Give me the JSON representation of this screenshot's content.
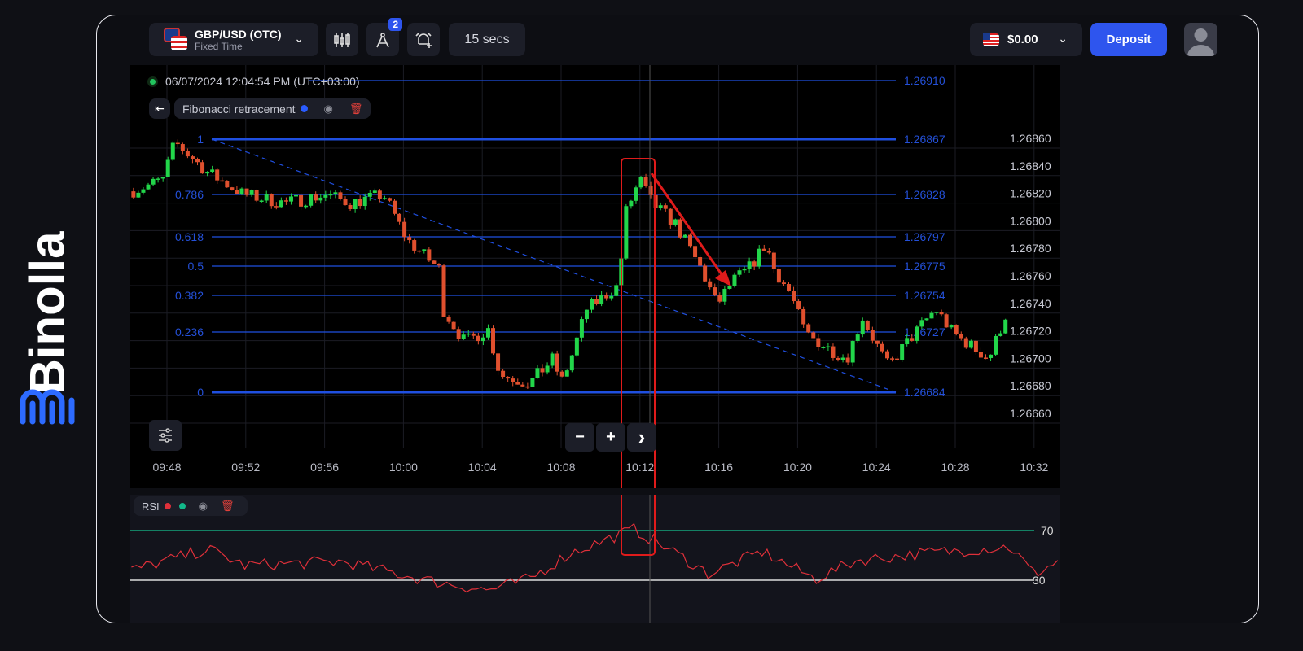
{
  "brand": "Binolla",
  "header": {
    "asset": "GBP/USD (OTC)",
    "asset_type": "Fixed Time",
    "drawings_badge": "2",
    "timeframe": "15 secs",
    "balance": "$0.00",
    "deposit": "Deposit"
  },
  "chart": {
    "timestamp": "06/07/2024 12:04:54 PM  (UTC+03:00)",
    "indicator_label": "Fibonacci retracement",
    "fib_levels": [
      {
        "ratio": "",
        "price": "1.26910"
      },
      {
        "ratio": "1",
        "price": "1.26867"
      },
      {
        "ratio": "0.786",
        "price": "1.26828"
      },
      {
        "ratio": "0.618",
        "price": "1.26797"
      },
      {
        "ratio": "0.5",
        "price": "1.26775"
      },
      {
        "ratio": "0.382",
        "price": "1.26754"
      },
      {
        "ratio": "0.236",
        "price": "1.26727"
      },
      {
        "ratio": "0",
        "price": "1.26684"
      }
    ],
    "price_ticks": [
      "1.26860",
      "1.26840",
      "1.26820",
      "1.26800",
      "1.26780",
      "1.26760",
      "1.26740",
      "1.26720",
      "1.26700",
      "1.26680",
      "1.26660"
    ],
    "time_ticks": [
      "09:48",
      "09:52",
      "09:56",
      "10:00",
      "10:04",
      "10:08",
      "10:12",
      "10:16",
      "10:20",
      "10:24",
      "10:28",
      "10:32"
    ],
    "zoom_out": "−",
    "zoom_in": "+",
    "next": "›",
    "colors": {
      "up": "#22d64a",
      "down": "#e0502e",
      "fib": "#1f4fe0",
      "annotation": "#e01b1b"
    }
  },
  "chart_data": {
    "type": "candlestick",
    "x_unit": "minutes after 09:48",
    "price_path": [
      [
        -1.7,
        1.26822
      ],
      [
        -0.2,
        1.2683
      ],
      [
        0.4,
        1.26857
      ],
      [
        2.1,
        1.26835
      ],
      [
        3.9,
        1.26819
      ],
      [
        6.0,
        1.26813
      ],
      [
        8.1,
        1.26819
      ],
      [
        9.3,
        1.26813
      ],
      [
        11.0,
        1.26819
      ],
      [
        12.2,
        1.26786
      ],
      [
        13.8,
        1.26765
      ],
      [
        14.0,
        1.26736
      ],
      [
        15.1,
        1.26712
      ],
      [
        16.3,
        1.26721
      ],
      [
        16.9,
        1.26688
      ],
      [
        18.4,
        1.26682
      ],
      [
        19.6,
        1.267
      ],
      [
        20.0,
        1.26682
      ],
      [
        20.5,
        1.267
      ],
      [
        21.3,
        1.26736
      ],
      [
        22.9,
        1.26753
      ],
      [
        23.3,
        1.26807
      ],
      [
        24.0,
        1.2683
      ],
      [
        24.6,
        1.26813
      ],
      [
        25.8,
        1.26798
      ],
      [
        27.1,
        1.26765
      ],
      [
        27.9,
        1.26739
      ],
      [
        28.7,
        1.26756
      ],
      [
        29.5,
        1.26765
      ],
      [
        30.4,
        1.26783
      ],
      [
        30.8,
        1.26765
      ],
      [
        31.6,
        1.26748
      ],
      [
        32.4,
        1.26718
      ],
      [
        33.7,
        1.26706
      ],
      [
        34.5,
        1.267
      ],
      [
        35.3,
        1.2673
      ],
      [
        35.7,
        1.26718
      ],
      [
        36.6,
        1.26694
      ],
      [
        37.4,
        1.26709
      ],
      [
        39.0,
        1.26736
      ],
      [
        39.9,
        1.26718
      ],
      [
        41.1,
        1.26706
      ],
      [
        41.7,
        1.267
      ],
      [
        42.6,
        1.26733
      ]
    ],
    "rsi": {
      "label": "RSI",
      "upper": "70",
      "lower": "30",
      "path": [
        [
          -1.8,
          38
        ],
        [
          2.1,
          55
        ],
        [
          3.9,
          42
        ],
        [
          8.9,
          45
        ],
        [
          13.5,
          29
        ],
        [
          16.3,
          22
        ],
        [
          18.4,
          31
        ],
        [
          20.5,
          52
        ],
        [
          23.7,
          71
        ],
        [
          25.8,
          52
        ],
        [
          27.5,
          35
        ],
        [
          30.2,
          53
        ],
        [
          32.9,
          31
        ],
        [
          35.0,
          46
        ],
        [
          38.6,
          52
        ],
        [
          42.8,
          57
        ],
        [
          44.0,
          35
        ],
        [
          45.2,
          45
        ]
      ]
    }
  },
  "rsi_panel": {
    "label": "RSI"
  }
}
